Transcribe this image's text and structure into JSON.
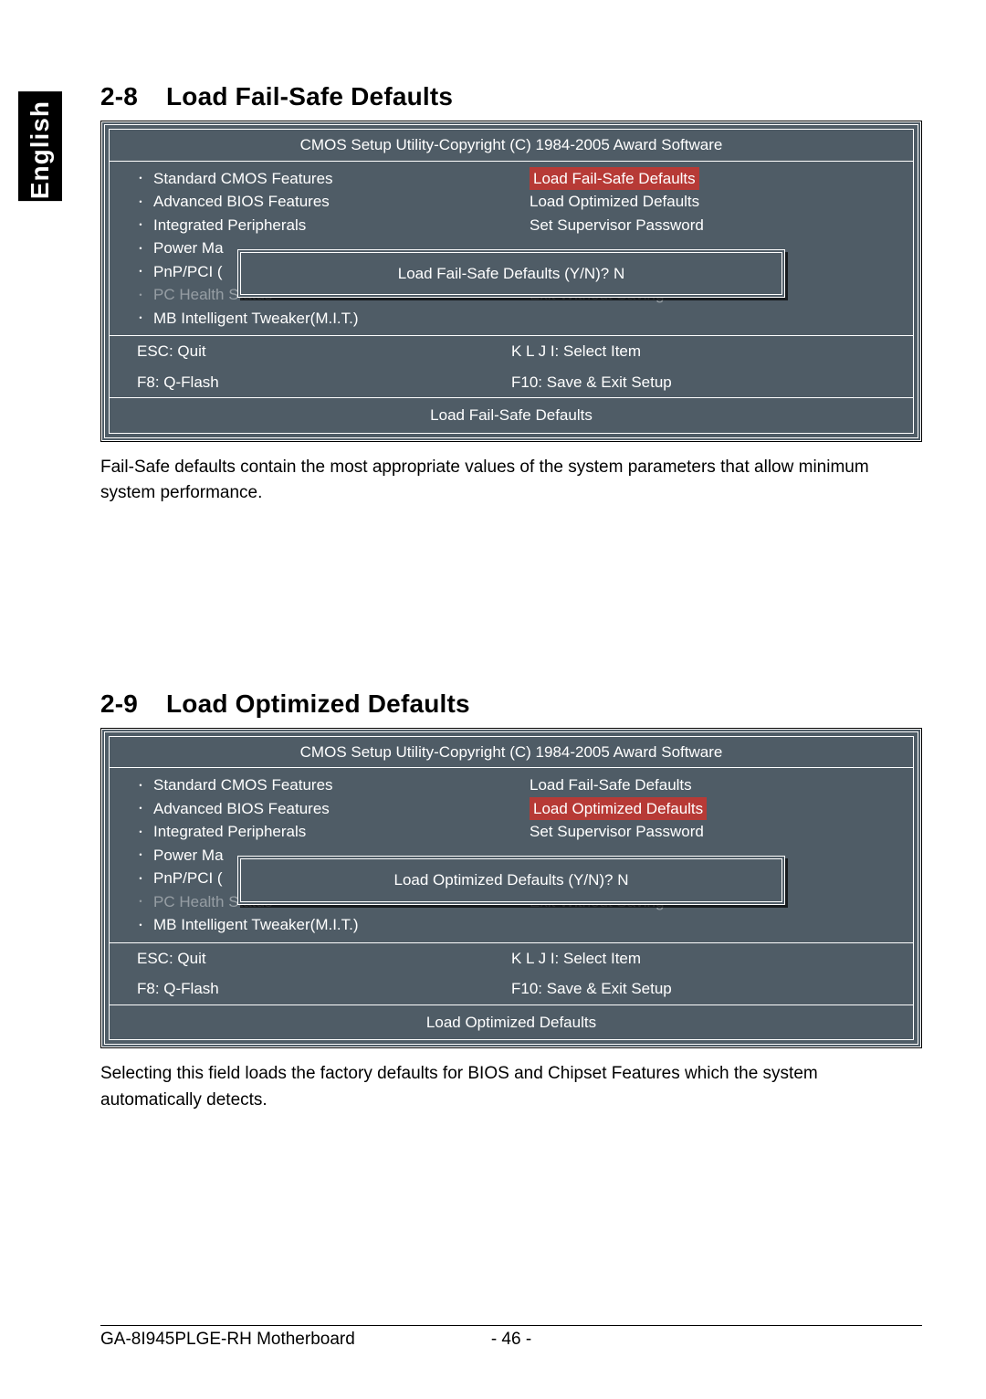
{
  "language_tab": "English",
  "section1": {
    "number": "2-8",
    "title": "Load Fail-Safe Defaults",
    "bios": {
      "title": "CMOS Setup Utility-Copyright (C) 1984-2005 Award Software",
      "left_items": [
        "Standard CMOS Features",
        "Advanced BIOS Features",
        "Integrated Peripherals",
        "Power Ma",
        "PnP/PCI (",
        "PC Health Status",
        "MB Intelligent Tweaker(M.I.T.)"
      ],
      "right_items": [
        "Load Fail-Safe Defaults",
        "Load Optimized Defaults",
        "Set Supervisor Password",
        "",
        "",
        "Exit Without Saving",
        ""
      ],
      "highlight_right_index": 0,
      "dialog": "Load Fail-Safe Defaults (Y/N)? N",
      "keys": {
        "esc": "ESC: Quit",
        "select": "K L J I: Select Item",
        "f8": "F8:  Q-Flash",
        "f10": "F10: Save & Exit Setup"
      },
      "description": "Load Fail-Safe Defaults"
    },
    "paragraph": "Fail-Safe defaults contain the most appropriate values of the system parameters that allow minimum system performance."
  },
  "section2": {
    "number": "2-9",
    "title": "Load Optimized Defaults",
    "bios": {
      "title": "CMOS Setup Utility-Copyright (C) 1984-2005 Award Software",
      "left_items": [
        "Standard CMOS Features",
        "Advanced BIOS Features",
        "Integrated Peripherals",
        "Power Ma",
        "PnP/PCI (",
        "PC Health Status",
        "MB Intelligent Tweaker(M.I.T.)"
      ],
      "right_items": [
        "Load Fail-Safe Defaults",
        "Load Optimized Defaults",
        "Set Supervisor Password",
        "",
        "",
        "Exit Without Saving",
        ""
      ],
      "highlight_right_index": 1,
      "dialog": "Load Optimized Defaults (Y/N)? N",
      "keys": {
        "esc": "ESC: Quit",
        "select": "K L J I: Select Item",
        "f8": "F8:  Q-Flash",
        "f10": "F10: Save & Exit Setup"
      },
      "description": "Load Optimized Defaults"
    },
    "paragraph": "Selecting this field loads the factory defaults for BIOS and Chipset Features which the system automatically detects."
  },
  "footer": {
    "product": "GA-8I945PLGE-RH Motherboard",
    "page": "- 46 -"
  }
}
